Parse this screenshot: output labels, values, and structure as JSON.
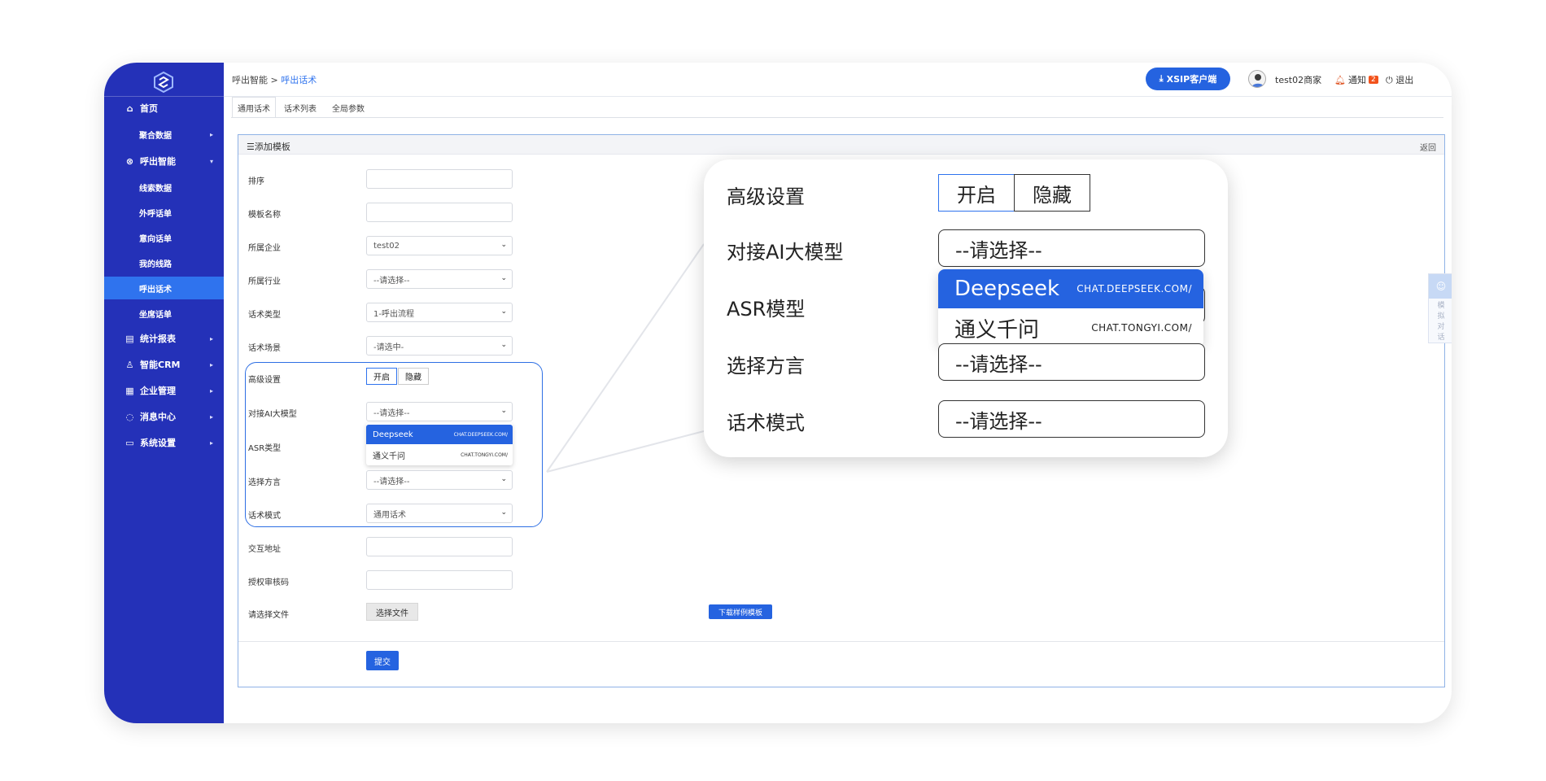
{
  "sidebar": {
    "items": [
      {
        "label": "首页",
        "icon": "home-icon",
        "level": "top",
        "caret": false
      },
      {
        "label": "聚合数据",
        "level": "sub",
        "caret": true
      },
      {
        "label": "呼出智能",
        "icon": "outbound-icon",
        "level": "top",
        "caret": true,
        "expanded": true
      },
      {
        "label": "线索数据",
        "level": "sub"
      },
      {
        "label": "外呼话单",
        "level": "sub"
      },
      {
        "label": "意向话单",
        "level": "sub"
      },
      {
        "label": "我的线路",
        "level": "sub"
      },
      {
        "label": "呼出话术",
        "level": "sub",
        "active": true
      },
      {
        "label": "坐席话单",
        "level": "sub"
      },
      {
        "label": "统计报表",
        "icon": "report-icon",
        "level": "top",
        "caret": true
      },
      {
        "label": "智能CRM",
        "icon": "crm-icon",
        "level": "top",
        "caret": true
      },
      {
        "label": "企业管理",
        "icon": "building-icon",
        "level": "top",
        "caret": true
      },
      {
        "label": "消息中心",
        "icon": "message-icon",
        "level": "top",
        "caret": true
      },
      {
        "label": "系统设置",
        "icon": "settings-icon",
        "level": "top",
        "caret": true
      }
    ]
  },
  "header": {
    "breadcrumb_parent": "呼出智能 >",
    "breadcrumb_current": "呼出话术",
    "xsip_label": "XSIP客户端",
    "username": "test02商家",
    "notice_label": "通知",
    "notice_count": "2",
    "logout_label": "退出"
  },
  "tabs": [
    {
      "label": "通用话术",
      "active": true
    },
    {
      "label": "话术列表"
    },
    {
      "label": "全局参数"
    }
  ],
  "panel": {
    "title": "添加模板",
    "back_label": "返回"
  },
  "form": {
    "sort_label": "排序",
    "name_label": "模板名称",
    "company_label": "所属企业",
    "company_value": "test02",
    "industry_label": "所属行业",
    "industry_value": "--请选择--",
    "type_label": "话术类型",
    "type_value": "1-呼出流程",
    "scene_label": "话术场景",
    "scene_value": "-请选中-",
    "advanced_label": "高级设置",
    "advanced_on": "开启",
    "advanced_off": "隐藏",
    "ai_label": "对接AI大模型",
    "ai_value": "--请选择--",
    "asr_label": "ASR类型",
    "dialect_label": "选择方言",
    "dialect_value": "--请选择--",
    "mode_label": "话术模式",
    "mode_value": "通用话术",
    "interact_label": "交互地址",
    "auth_label": "授权审核码",
    "file_label": "请选择文件",
    "file_button": "选择文件",
    "download_button": "下载样例模板",
    "submit_button": "提交"
  },
  "ai_options": [
    {
      "name": "Deepseek",
      "url": "CHAT.DEEPSEEK.COM/",
      "selected": true
    },
    {
      "name": "通义千问",
      "url": "CHAT.TONGYI.COM/"
    }
  ],
  "float_widget": {
    "chars": [
      "模",
      "拟",
      "对",
      "话"
    ]
  },
  "zoom": {
    "advanced_label": "高级设置",
    "advanced_on": "开启",
    "advanced_off": "隐藏",
    "ai_label": "对接AI大模型",
    "ai_value": "--请选择--",
    "asr_label": "ASR模型",
    "dialect_label": "选择方言",
    "dialect_value": "--请选择--",
    "mode_label": "话术模式",
    "mode_value": "--请选择--"
  },
  "colors": {
    "sidebar": "#2431b8",
    "accent": "#2563e0",
    "active_nav": "#2f73ee",
    "highlight_border": "#2e6fe4",
    "badge": "#f2521b"
  }
}
